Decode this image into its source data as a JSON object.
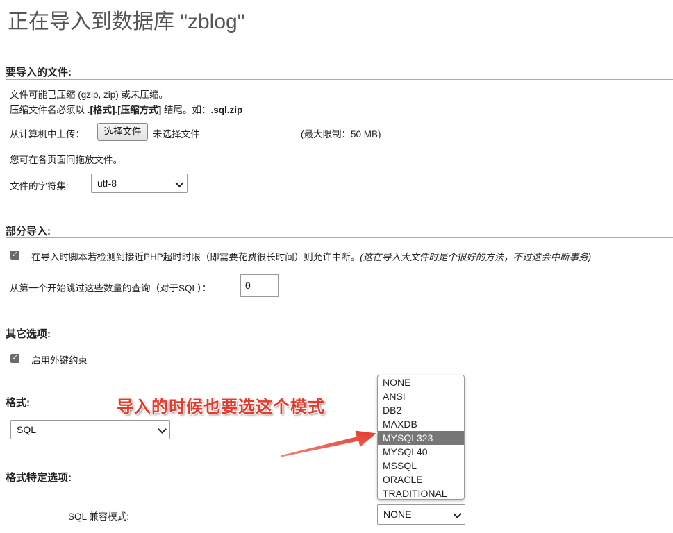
{
  "page_title": "正在导入到数据库 \"zblog\"",
  "sections": {
    "file": {
      "heading": "要导入的文件:",
      "note_line1": "文件可能已压缩 (gzip, zip) 或未压缩。",
      "note_line2_prefix": "压缩文件名必须以 ",
      "note_line2_bold": ".[格式].[压缩方式]",
      "note_line2_mid": " 结尾。如：",
      "note_line2_example": ".sql.zip",
      "upload_label": "从计算机中上传：",
      "choose_file_button": "选择文件",
      "no_file_text": "未选择文件",
      "max_limit": "(最大限制：50 MB)",
      "drag_hint": "您可在各页面间拖放文件。",
      "charset_label": "文件的字符集:",
      "charset_value": "utf-8"
    },
    "partial": {
      "heading": "部分导入:",
      "interrupt_text": "在导入时脚本若检测到接近PHP超时时限（即需要花费很长时间）则允许中断。",
      "interrupt_hint": "(这在导入大文件时是个很好的方法，不过这会中断事务)",
      "interrupt_checked": true,
      "skip_label": "从第一个开始跳过这些数量的查询（对于SQL）：",
      "skip_value": "0"
    },
    "other": {
      "heading": "其它选项:",
      "fk_label": "启用外键约束",
      "fk_checked": true
    },
    "format": {
      "heading": "格式:",
      "format_value": "SQL"
    },
    "format_specific": {
      "heading": "格式特定选项:",
      "compat_label": "SQL 兼容模式:",
      "compat_value": "NONE",
      "compat_options": [
        "NONE",
        "ANSI",
        "DB2",
        "MAXDB",
        "MYSQL323",
        "MYSQL40",
        "MSSQL",
        "ORACLE",
        "TRADITIONAL"
      ],
      "highlighted_option": "MYSQL323"
    }
  },
  "annotation": {
    "text": "导入的时候也要选这个模式",
    "color": "#e53a2a"
  },
  "icons": {
    "checkmark": "check-icon",
    "chevron": "chevron-down-icon",
    "arrow": "red-arrow-icon"
  }
}
